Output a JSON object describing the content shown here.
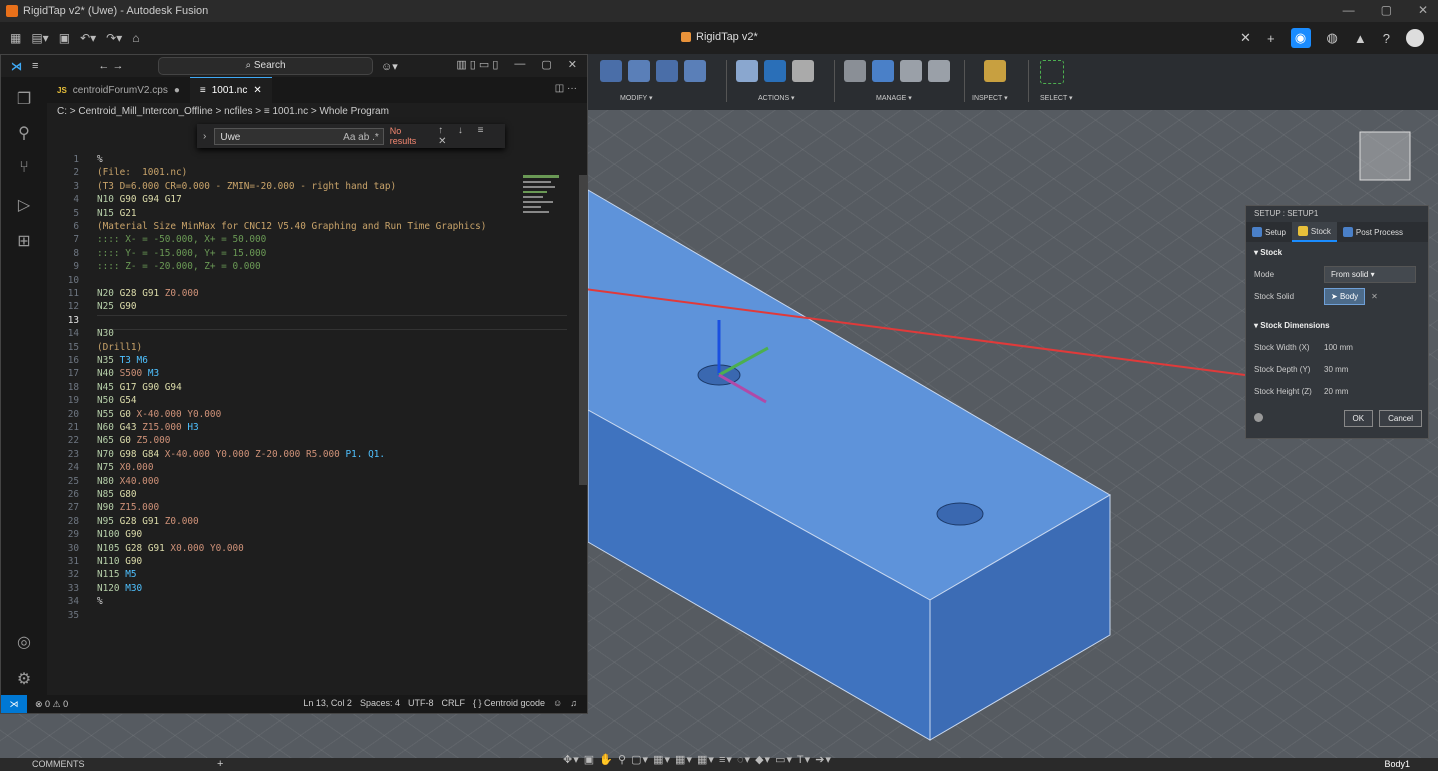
{
  "fusion": {
    "window_title": "RigidTap v2* (Uwe) - Autodesk Fusion",
    "doc_tab": "RigidTap v2*",
    "toolbar": {
      "groups": [
        "MODIFY ▾",
        "ACTIONS ▾",
        "MANAGE ▾",
        "INSPECT ▾",
        "SELECT ▾"
      ]
    },
    "bottom": {
      "comments": "COMMENTS",
      "plus": "+",
      "body": "Body1"
    },
    "colors": {
      "accent": "#1a8cff",
      "body": "#4a7fc8",
      "arrow": "#e03a3a"
    }
  },
  "setup_panel": {
    "title": "SETUP : SETUP1",
    "tabs": [
      "Setup",
      "Stock",
      "Post Process"
    ],
    "section_stock": "Stock",
    "mode_label": "Mode",
    "mode_value": "From solid",
    "stock_solid_label": "Stock Solid",
    "stock_solid_value": "Body",
    "section_dims": "Stock Dimensions",
    "dims": [
      {
        "label": "Stock Width (X)",
        "value": "100 mm"
      },
      {
        "label": "Stock Depth (Y)",
        "value": "30 mm"
      },
      {
        "label": "Stock Height (Z)",
        "value": "20 mm"
      }
    ],
    "ok": "OK",
    "cancel": "Cancel"
  },
  "vscode": {
    "search": "Search",
    "tabs": [
      {
        "icon": "JS",
        "label": "centroidForumV2.cps",
        "dot": "●"
      },
      {
        "icon": "≡",
        "label": "1001.nc",
        "close": "✕"
      }
    ],
    "breadcrumb": "C: > Centroid_Mill_Intercon_Offline > ncfiles > ≡ 1001.nc > Whole Program",
    "find": {
      "value": "Uwe",
      "opts": "Aa ab .*",
      "result": "No results",
      "controls": "↑ ↓ ≡ ✕"
    },
    "lines": [
      {
        "n": "1",
        "t": "%"
      },
      {
        "n": "2",
        "t": "(File:  1001.nc)"
      },
      {
        "n": "3",
        "t": "(T3 D=6.000 CR=0.000 - ZMIN=-20.000 - right hand tap)"
      },
      {
        "n": "4",
        "t": "N10 G90 G94 G17"
      },
      {
        "n": "5",
        "t": "N15 G21"
      },
      {
        "n": "6",
        "t": "(Material Size MinMax for CNC12 V5.40 Graphing and Run Time Graphics)"
      },
      {
        "n": "7",
        "t": ":::: X- = -50.000, X+ = 50.000"
      },
      {
        "n": "8",
        "t": ":::: Y- = -15.000, Y+ = 15.000"
      },
      {
        "n": "9",
        "t": ":::: Z- = -20.000, Z+ = 0.000"
      },
      {
        "n": "10",
        "t": ""
      },
      {
        "n": "11",
        "t": "N20 G28 G91 Z0.000"
      },
      {
        "n": "12",
        "t": "N25 G90"
      },
      {
        "n": "13",
        "t": ""
      },
      {
        "n": "14",
        "t": "N30"
      },
      {
        "n": "15",
        "t": "(Drill1)"
      },
      {
        "n": "16",
        "t": "N35 T3 M6"
      },
      {
        "n": "17",
        "t": "N40 S500 M3"
      },
      {
        "n": "18",
        "t": "N45 G17 G90 G94"
      },
      {
        "n": "19",
        "t": "N50 G54"
      },
      {
        "n": "20",
        "t": "N55 G0 X-40.000 Y0.000"
      },
      {
        "n": "21",
        "t": "N60 G43 Z15.000 H3"
      },
      {
        "n": "22",
        "t": "N65 G0 Z5.000"
      },
      {
        "n": "23",
        "t": "N70 G98 G84 X-40.000 Y0.000 Z-20.000 R5.000 P1. Q1."
      },
      {
        "n": "24",
        "t": "N75 X0.000"
      },
      {
        "n": "25",
        "t": "N80 X40.000"
      },
      {
        "n": "26",
        "t": "N85 G80"
      },
      {
        "n": "27",
        "t": "N90 Z15.000"
      },
      {
        "n": "28",
        "t": "N95 G28 G91 Z0.000"
      },
      {
        "n": "29",
        "t": "N100 G90"
      },
      {
        "n": "30",
        "t": "N105 G28 G91 X0.000 Y0.000"
      },
      {
        "n": "31",
        "t": "N110 G90"
      },
      {
        "n": "32",
        "t": "N115 M5"
      },
      {
        "n": "33",
        "t": "N120 M30"
      },
      {
        "n": "34",
        "t": "%"
      },
      {
        "n": "35",
        "t": ""
      }
    ],
    "status": {
      "errors": "⊗ 0 ⚠ 0",
      "position": "Ln 13, Col 2",
      "spaces": "Spaces: 4",
      "encoding": "UTF-8",
      "eol": "CRLF",
      "lang": "{ } Centroid gcode"
    }
  }
}
